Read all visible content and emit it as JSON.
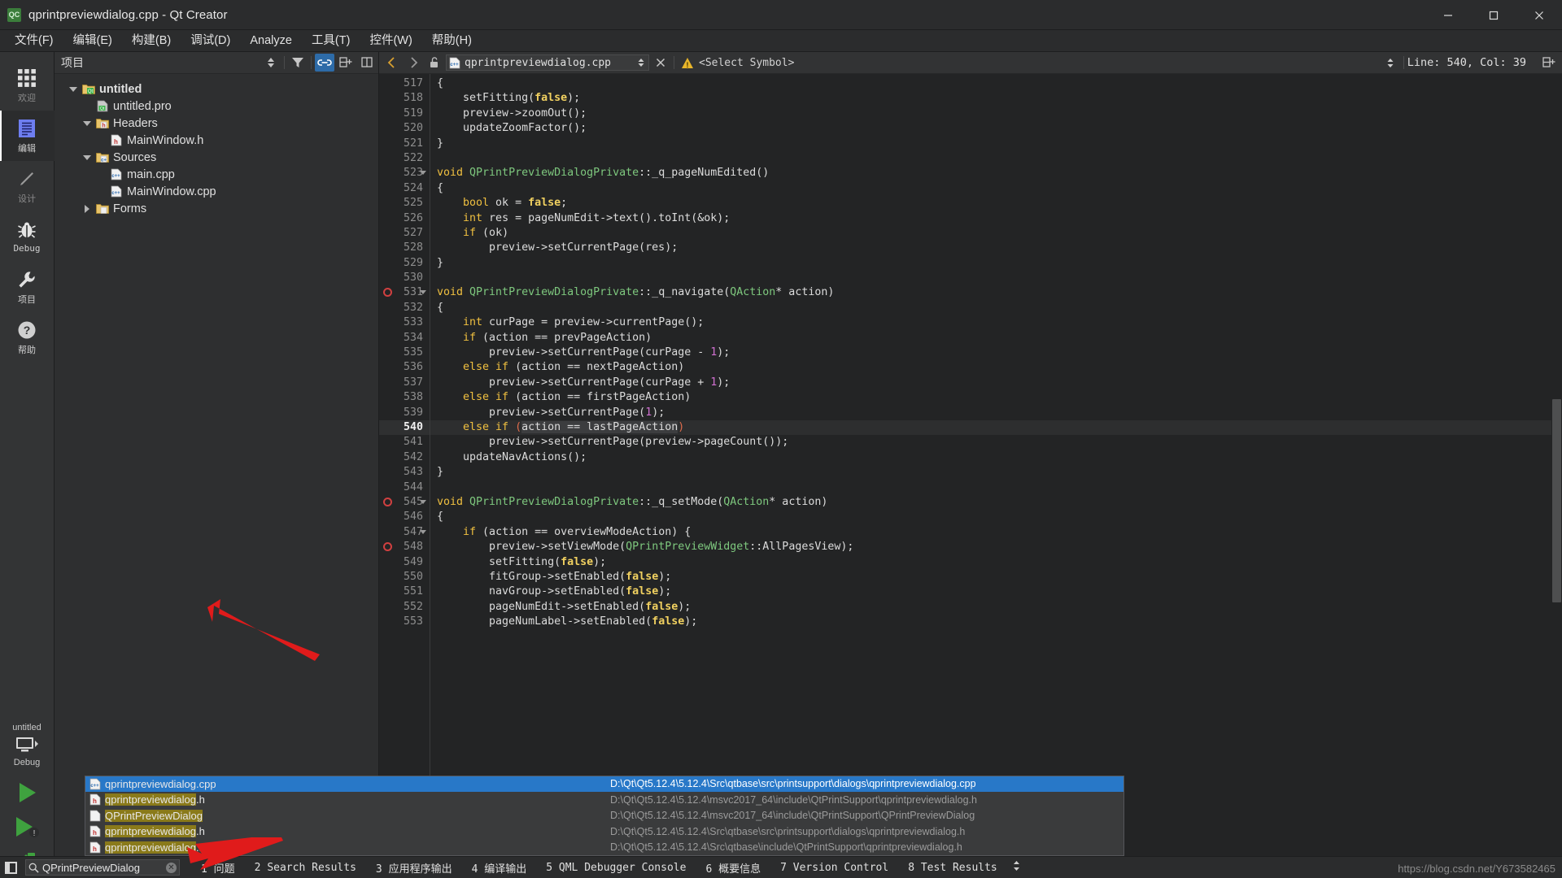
{
  "window": {
    "title": "qprintpreviewdialog.cpp - Qt Creator",
    "logo_text": "QC",
    "minimize": "─",
    "maximize": "☐",
    "close": "✕"
  },
  "menubar": {
    "items": [
      {
        "label": "文件(F)",
        "name": "menu-file"
      },
      {
        "label": "编辑(E)",
        "name": "menu-edit"
      },
      {
        "label": "构建(B)",
        "name": "menu-build"
      },
      {
        "label": "调试(D)",
        "name": "menu-debug"
      },
      {
        "label": "Analyze",
        "name": "menu-analyze"
      },
      {
        "label": "工具(T)",
        "name": "menu-tools"
      },
      {
        "label": "控件(W)",
        "name": "menu-window"
      },
      {
        "label": "帮助(H)",
        "name": "menu-help"
      }
    ]
  },
  "modebar": {
    "modes": [
      {
        "label": "欢迎",
        "icon": "grid-icon",
        "active": false
      },
      {
        "label": "编辑",
        "icon": "document-icon",
        "active": true
      },
      {
        "label": "设计",
        "icon": "pencil-icon",
        "active": false
      },
      {
        "label": "Debug",
        "icon": "bug-icon",
        "active": false
      },
      {
        "label": "项目",
        "icon": "wrench-icon",
        "active": false
      },
      {
        "label": "帮助",
        "icon": "question-icon",
        "active": false
      }
    ],
    "kit": {
      "project": "untitled",
      "build_config": "Debug"
    }
  },
  "project_pane": {
    "header_title": "项目",
    "tree": [
      {
        "label": "untitled",
        "level": 0,
        "expander": "down",
        "icon": "qt-project-icon",
        "bold": true
      },
      {
        "label": "untitled.pro",
        "level": 1,
        "expander": "none",
        "icon": "pro-file-icon",
        "bold": false
      },
      {
        "label": "Headers",
        "level": 1,
        "expander": "down",
        "icon": "headers-folder-icon",
        "bold": false
      },
      {
        "label": "MainWindow.h",
        "level": 2,
        "expander": "none",
        "icon": "h-file-icon",
        "bold": false
      },
      {
        "label": "Sources",
        "level": 1,
        "expander": "down",
        "icon": "sources-folder-icon",
        "bold": false
      },
      {
        "label": "main.cpp",
        "level": 2,
        "expander": "none",
        "icon": "cpp-file-icon",
        "bold": false
      },
      {
        "label": "MainWindow.cpp",
        "level": 2,
        "expander": "none",
        "icon": "cpp-file-icon",
        "bold": false
      },
      {
        "label": "Forms",
        "level": 1,
        "expander": "right",
        "icon": "forms-folder-icon",
        "bold": false
      }
    ]
  },
  "editor_toolbar": {
    "filename": "qprintpreviewdialog.cpp",
    "symbol_selector": "<Select Symbol>",
    "line_col": "Line: 540, Col: 39"
  },
  "code": {
    "first_line": 517,
    "current_line": 540,
    "breakpoint_lines": [
      531,
      545,
      548
    ],
    "fold_lines": [
      523,
      531,
      545,
      547
    ],
    "lines": [
      {
        "n": 517,
        "tokens": [
          {
            "t": "{",
            "c": "par"
          }
        ]
      },
      {
        "n": 518,
        "tokens": [
          {
            "t": "    setFitting(",
            "c": "fn"
          },
          {
            "t": "false",
            "c": "lit"
          },
          {
            "t": ");",
            "c": "fn"
          }
        ]
      },
      {
        "n": 519,
        "tokens": [
          {
            "t": "    preview->zoomOut();",
            "c": "fn"
          }
        ]
      },
      {
        "n": 520,
        "tokens": [
          {
            "t": "    updateZoomFactor();",
            "c": "fn"
          }
        ]
      },
      {
        "n": 521,
        "tokens": [
          {
            "t": "}",
            "c": "par"
          }
        ]
      },
      {
        "n": 522,
        "tokens": []
      },
      {
        "n": 523,
        "tokens": [
          {
            "t": "void ",
            "c": "k"
          },
          {
            "t": "QPrintPreviewDialogPrivate",
            "c": "typ"
          },
          {
            "t": "::_q_pageNumEdited()",
            "c": "fn"
          }
        ]
      },
      {
        "n": 524,
        "tokens": [
          {
            "t": "{",
            "c": "par"
          }
        ]
      },
      {
        "n": 525,
        "tokens": [
          {
            "t": "    bool",
            "c": "k"
          },
          {
            "t": " ok = ",
            "c": "fn"
          },
          {
            "t": "false",
            "c": "lit"
          },
          {
            "t": ";",
            "c": "fn"
          }
        ]
      },
      {
        "n": 526,
        "tokens": [
          {
            "t": "    int",
            "c": "k"
          },
          {
            "t": " res = pageNumEdit->text().toInt(&ok);",
            "c": "fn"
          }
        ]
      },
      {
        "n": 527,
        "tokens": [
          {
            "t": "    if",
            "c": "k"
          },
          {
            "t": " (ok)",
            "c": "fn"
          }
        ]
      },
      {
        "n": 528,
        "tokens": [
          {
            "t": "        preview->setCurrentPage(res);",
            "c": "fn"
          }
        ]
      },
      {
        "n": 529,
        "tokens": [
          {
            "t": "}",
            "c": "par"
          }
        ]
      },
      {
        "n": 530,
        "tokens": []
      },
      {
        "n": 531,
        "tokens": [
          {
            "t": "void ",
            "c": "k"
          },
          {
            "t": "QPrintPreviewDialogPrivate",
            "c": "typ"
          },
          {
            "t": "::_q_navigate(",
            "c": "fn"
          },
          {
            "t": "QAction",
            "c": "typ"
          },
          {
            "t": "* action)",
            "c": "fn"
          }
        ]
      },
      {
        "n": 532,
        "tokens": [
          {
            "t": "{",
            "c": "par"
          }
        ]
      },
      {
        "n": 533,
        "tokens": [
          {
            "t": "    int",
            "c": "k"
          },
          {
            "t": " curPage = preview->currentPage();",
            "c": "fn"
          }
        ]
      },
      {
        "n": 534,
        "tokens": [
          {
            "t": "    if",
            "c": "k"
          },
          {
            "t": " (action == prevPageAction)",
            "c": "fn"
          }
        ]
      },
      {
        "n": 535,
        "tokens": [
          {
            "t": "        preview->setCurrentPage(curPage - ",
            "c": "fn"
          },
          {
            "t": "1",
            "c": "num"
          },
          {
            "t": ");",
            "c": "fn"
          }
        ]
      },
      {
        "n": 536,
        "tokens": [
          {
            "t": "    else if",
            "c": "k"
          },
          {
            "t": " (action == nextPageAction)",
            "c": "fn"
          }
        ]
      },
      {
        "n": 537,
        "tokens": [
          {
            "t": "        preview->setCurrentPage(curPage + ",
            "c": "fn"
          },
          {
            "t": "1",
            "c": "num"
          },
          {
            "t": ");",
            "c": "fn"
          }
        ]
      },
      {
        "n": 538,
        "tokens": [
          {
            "t": "    else if",
            "c": "k"
          },
          {
            "t": " (action == firstPageAction)",
            "c": "fn"
          }
        ]
      },
      {
        "n": 539,
        "tokens": [
          {
            "t": "        preview->setCurrentPage(",
            "c": "fn"
          },
          {
            "t": "1",
            "c": "num"
          },
          {
            "t": ");",
            "c": "fn"
          }
        ]
      },
      {
        "n": 540,
        "tokens": [
          {
            "t": "    else if",
            "c": "k"
          },
          {
            "t": " ",
            "c": "fn"
          },
          {
            "t": "(",
            "c": "parhl"
          },
          {
            "t": "action == lastPageAction",
            "c": "selhl"
          },
          {
            "t": ")",
            "c": "parhl"
          }
        ]
      },
      {
        "n": 541,
        "tokens": [
          {
            "t": "        preview->setCurrentPage(preview->pageCount());",
            "c": "fn"
          }
        ]
      },
      {
        "n": 542,
        "tokens": [
          {
            "t": "    updateNavActions();",
            "c": "fn"
          }
        ]
      },
      {
        "n": 543,
        "tokens": [
          {
            "t": "}",
            "c": "par"
          }
        ]
      },
      {
        "n": 544,
        "tokens": []
      },
      {
        "n": 545,
        "tokens": [
          {
            "t": "void ",
            "c": "k"
          },
          {
            "t": "QPrintPreviewDialogPrivate",
            "c": "typ"
          },
          {
            "t": "::_q_setMode(",
            "c": "fn"
          },
          {
            "t": "QAction",
            "c": "typ"
          },
          {
            "t": "* action)",
            "c": "fn"
          }
        ]
      },
      {
        "n": 546,
        "tokens": [
          {
            "t": "{",
            "c": "par"
          }
        ]
      },
      {
        "n": 547,
        "tokens": [
          {
            "t": "    if",
            "c": "k"
          },
          {
            "t": " (action == overviewModeAction) {",
            "c": "fn"
          }
        ]
      },
      {
        "n": 548,
        "tokens": [
          {
            "t": "        preview->setViewMode(",
            "c": "fn"
          },
          {
            "t": "QPrintPreviewWidget",
            "c": "typ"
          },
          {
            "t": "::AllPagesView);",
            "c": "fn"
          }
        ]
      },
      {
        "n": 549,
        "tokens": [
          {
            "t": "        setFitting(",
            "c": "fn"
          },
          {
            "t": "false",
            "c": "lit"
          },
          {
            "t": ");",
            "c": "fn"
          }
        ]
      },
      {
        "n": 550,
        "tokens": [
          {
            "t": "        fitGroup->setEnabled(",
            "c": "fn"
          },
          {
            "t": "false",
            "c": "lit"
          },
          {
            "t": ");",
            "c": "fn"
          }
        ]
      },
      {
        "n": 551,
        "tokens": [
          {
            "t": "        navGroup->setEnabled(",
            "c": "fn"
          },
          {
            "t": "false",
            "c": "lit"
          },
          {
            "t": ");",
            "c": "fn"
          }
        ]
      },
      {
        "n": 552,
        "tokens": [
          {
            "t": "        pageNumEdit->setEnabled(",
            "c": "fn"
          },
          {
            "t": "false",
            "c": "lit"
          },
          {
            "t": ");",
            "c": "fn"
          }
        ]
      },
      {
        "n": 553,
        "tokens": [
          {
            "t": "        pageNumLabel->setEnabled(",
            "c": "fn"
          },
          {
            "t": "false",
            "c": "lit"
          },
          {
            "t": ");",
            "c": "fn"
          }
        ]
      }
    ]
  },
  "locator_results": {
    "rows": [
      {
        "icon": "cpp-file-icon",
        "name": "qprintpreviewdialog",
        "suffix": ".cpp",
        "path": "D:\\Qt\\Qt5.12.4\\5.12.4\\Src\\qtbase\\src\\printsupport\\dialogs\\qprintpreviewdialog.cpp",
        "selected": true
      },
      {
        "icon": "h-file-icon",
        "name": "qprintpreviewdialog",
        "suffix": ".h",
        "path": "D:\\Qt\\Qt5.12.4\\5.12.4\\msvc2017_64\\include\\QtPrintSupport\\qprintpreviewdialog.h",
        "selected": false
      },
      {
        "icon": "plain-file-icon",
        "name": "QPrintPreviewDialog",
        "suffix": "",
        "path": "D:\\Qt\\Qt5.12.4\\5.12.4\\msvc2017_64\\include\\QtPrintSupport\\QPrintPreviewDialog",
        "selected": false
      },
      {
        "icon": "h-file-icon",
        "name": "qprintpreviewdialog",
        "suffix": ".h",
        "path": "D:\\Qt\\Qt5.12.4\\5.12.4\\Src\\qtbase\\src\\printsupport\\dialogs\\qprintpreviewdialog.h",
        "selected": false
      },
      {
        "icon": "h-file-icon",
        "name": "qprintpreviewdialog",
        "suffix": ".h",
        "path": "D:\\Qt\\Qt5.12.4\\5.12.4\\Src\\qtbase\\include\\QtPrintSupport\\qprintpreviewdialog.h",
        "selected": false
      }
    ]
  },
  "statusbar": {
    "locator_value": "QPrintPreviewDialog",
    "clear_glyph": "✕",
    "panes": [
      {
        "num": "1",
        "label": "问题"
      },
      {
        "num": "2",
        "label": "Search Results"
      },
      {
        "num": "3",
        "label": "应用程序输出"
      },
      {
        "num": "4",
        "label": "编译输出"
      },
      {
        "num": "5",
        "label": "QML Debugger Console"
      },
      {
        "num": "6",
        "label": "概要信息"
      },
      {
        "num": "7",
        "label": "Version Control"
      },
      {
        "num": "8",
        "label": "Test Results"
      }
    ],
    "watermark": "https://blog.csdn.net/Y673582465"
  },
  "colors": {
    "accent_blue": "#2878c8",
    "panel_bg": "#2e2f30",
    "editor_bg": "#232425",
    "breakpoint_red": "#d04040",
    "highlight_yellow": "#8a7a1a"
  }
}
